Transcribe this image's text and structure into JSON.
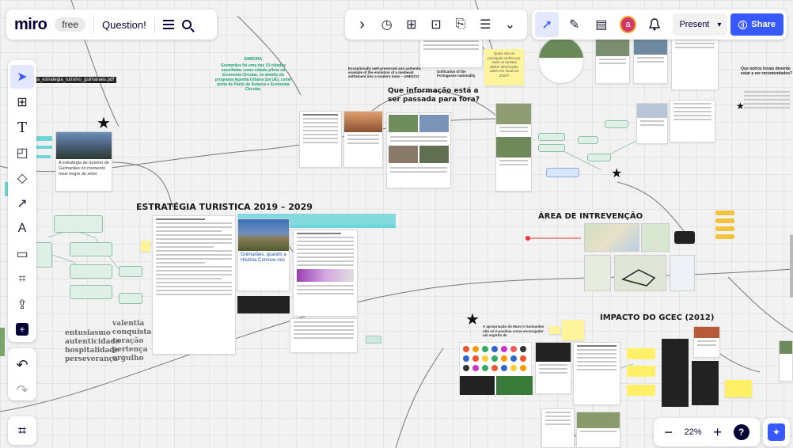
{
  "app": {
    "logo": "miro",
    "plan_badge": "free",
    "board_title": "Question!",
    "menu_icon": "hamburger-icon",
    "search_icon": "search-icon"
  },
  "top_tools": [
    {
      "name": "expand-icon",
      "glyph": "›"
    },
    {
      "name": "timer-icon",
      "glyph": "◷"
    },
    {
      "name": "add-frame-icon",
      "glyph": "⊞"
    },
    {
      "name": "focus-icon",
      "glyph": "⊡"
    },
    {
      "name": "vote-icon",
      "glyph": "⎘"
    },
    {
      "name": "notes-icon",
      "glyph": "☰"
    },
    {
      "name": "more-chevron-icon",
      "glyph": "⌄"
    }
  ],
  "collab_tools": [
    {
      "name": "cursor-select-icon",
      "glyph": "➚",
      "active": true
    },
    {
      "name": "celebrate-icon",
      "glyph": "✎"
    },
    {
      "name": "comment-icon",
      "glyph": "▤"
    },
    {
      "name": "user-avatar",
      "glyph": "a",
      "color": "#d4376b"
    },
    {
      "name": "bell-icon",
      "glyph": "🔔"
    }
  ],
  "present": {
    "label": "Present",
    "chevron": "▾"
  },
  "share": {
    "label": "Share",
    "icon": "globe-icon",
    "color": "#3859ff"
  },
  "left_tools": [
    {
      "name": "select-tool-icon",
      "glyph": "➤",
      "active": true
    },
    {
      "name": "frame-tool-icon",
      "glyph": "⊞"
    },
    {
      "name": "text-tool-icon",
      "glyph": "T"
    },
    {
      "name": "sticky-note-tool-icon",
      "glyph": "◰"
    },
    {
      "name": "shapes-tool-icon",
      "glyph": "◇"
    },
    {
      "name": "connector-tool-icon",
      "glyph": "↗"
    },
    {
      "name": "pen-tool-icon",
      "glyph": "A"
    },
    {
      "name": "comment-tool-icon",
      "glyph": "▭"
    },
    {
      "name": "crop-tool-icon",
      "glyph": "⌗"
    },
    {
      "name": "upload-tool-icon",
      "glyph": "⇪"
    },
    {
      "name": "more-apps-icon",
      "glyph": "+"
    }
  ],
  "undo_icon": "↶",
  "redo_icon": "↷",
  "frames_icon": "⌗",
  "zoom": {
    "level": "22%",
    "minus": "−",
    "plus": "+",
    "help": "?"
  },
  "board": {
    "headings": {
      "strategy": "ESTRATÉGIA TURISTICA 2019 – 2029",
      "question": "Que informação está a ser passada para fora?",
      "intervention_area": "ÁREA DE INTREVENÇÃO",
      "impact": "IMPACTO DO GCEC (2012)"
    },
    "pdf_filename": "biblica_estrategia_turismo_guimaraes.pdf",
    "left_card_title": "A estratégia de turismo de Guimarães no momento mais negro do setor",
    "center_card_title": "Guimarães, quando a História Comove-nos",
    "green_note": "Guimarães foi uma das 10 cidades escolhidas como cidade-piloto na Economia Circular, no âmbito do programa Agenda Urbana (da UE), como porta de Pacto de Autarca e Economia Circular.",
    "values_left": [
      "entusiasmo",
      "autenticidade",
      "hospitalidade",
      "perseverança"
    ],
    "values_right": [
      "valentia",
      "conquista",
      "coração",
      "pertença",
      "orgulho"
    ],
    "sticky_top": "Quais são as principais razões por onde os turistas obtêm informação sobre em local em 2022?",
    "top_caption_left": "Exceptionally well-preserved and authentic example of the evolution of a medieval settlement into a modern town – UNESCO",
    "top_caption_right": "Unification of the Portuguese nationality",
    "right_question": "Que outros locais deverão estar a ser recomendados?",
    "impact_quote": "A apropriação do Muro e Guimarães não só é positiva como encorajador um espírito de",
    "teal_header": "EMBORA"
  },
  "colors": {
    "accent": "#3859ff",
    "sticky_yellow": "#fff49b",
    "sticky_orange": "#f5c33b",
    "green_text": "#18a073"
  }
}
